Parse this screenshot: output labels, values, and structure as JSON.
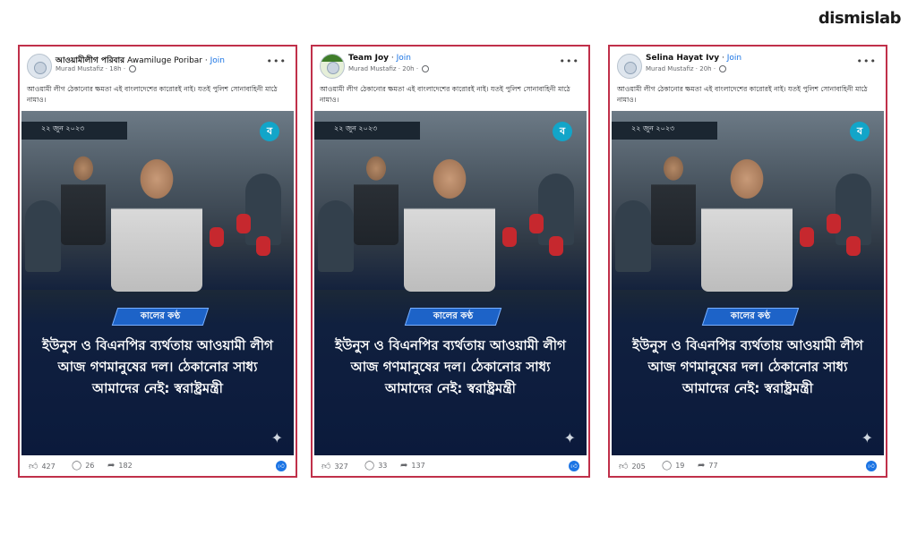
{
  "brand": "dismislab",
  "cards": [
    {
      "page_name": "আওয়ামীলীগ পরিবার",
      "page_name_en": "Awamiluge Poribar",
      "join": "Join",
      "author": "Murad Mustafiz",
      "time": "18h",
      "caption": "আওয়ামী লীগ ঠেকানোর ক্ষমতা এই বাংলাদেশের কারোরই নাই। যতই পুলিশ সোনাবাহিনী মাঠে নামাও।",
      "date": "২২ জুন ২০২৩",
      "tag": "কালের কণ্ঠ",
      "headline": "ইউনুস ও বিএনপির ব্যর্থতায় আওয়ামী লীগ আজ গণমানুষের দল। ঠেকানোর সাধ্য আমাদের নেই: স্বরাষ্ট্রমন্ত্রী",
      "likes": "427",
      "comments": "26",
      "shares": "182"
    },
    {
      "page_name": "Team Joy",
      "page_name_en": "",
      "join": "Join",
      "author": "Murad Mustafiz",
      "time": "20h",
      "caption": "আওয়ামী লীগ ঠেকানোর ক্ষমতা এই বাংলাদেশের কারোরই নাই। যতই পুলিশ সোনাবাহিনী মাঠে নামাও।",
      "date": "২২ জুন ২০২৩",
      "tag": "কালের কণ্ঠ",
      "headline": "ইউনুস ও বিএনপির ব্যর্থতায় আওয়ামী লীগ আজ গণমানুষের দল। ঠেকানোর সাধ্য আমাদের নেই: স্বরাষ্ট্রমন্ত্রী",
      "likes": "327",
      "comments": "33",
      "shares": "137"
    },
    {
      "page_name": "Selina Hayat Ivy",
      "page_name_en": "",
      "join": "Join",
      "author": "Murad Mustafiz",
      "time": "20h",
      "caption": "আওয়ামী লীগ ঠেকানোর ক্ষমতা এই বাংলাদেশের কারোরই নাই। যতই পুলিশ সোনাবাহিনী মাঠে নামাও।",
      "date": "২২ জুন ২০২৩",
      "tag": "কালের কণ্ঠ",
      "headline": "ইউনুস ও বিএনপির ব্যর্থতায় আওয়ামী লীগ আজ গণমানুষের দল। ঠেকানোর সাধ্য আমাদের নেই: স্বরাষ্ট্রমন্ত্রী",
      "likes": "205",
      "comments": "19",
      "shares": "77"
    }
  ],
  "colors": {
    "border": "#c0304a",
    "join": "#1b74e4",
    "tag": "#1d63c8"
  },
  "icons": {
    "like": "thumbs-up-icon",
    "comment": "comment-icon",
    "share": "share-icon",
    "more": "more-options-icon",
    "privacy": "globe-icon"
  }
}
